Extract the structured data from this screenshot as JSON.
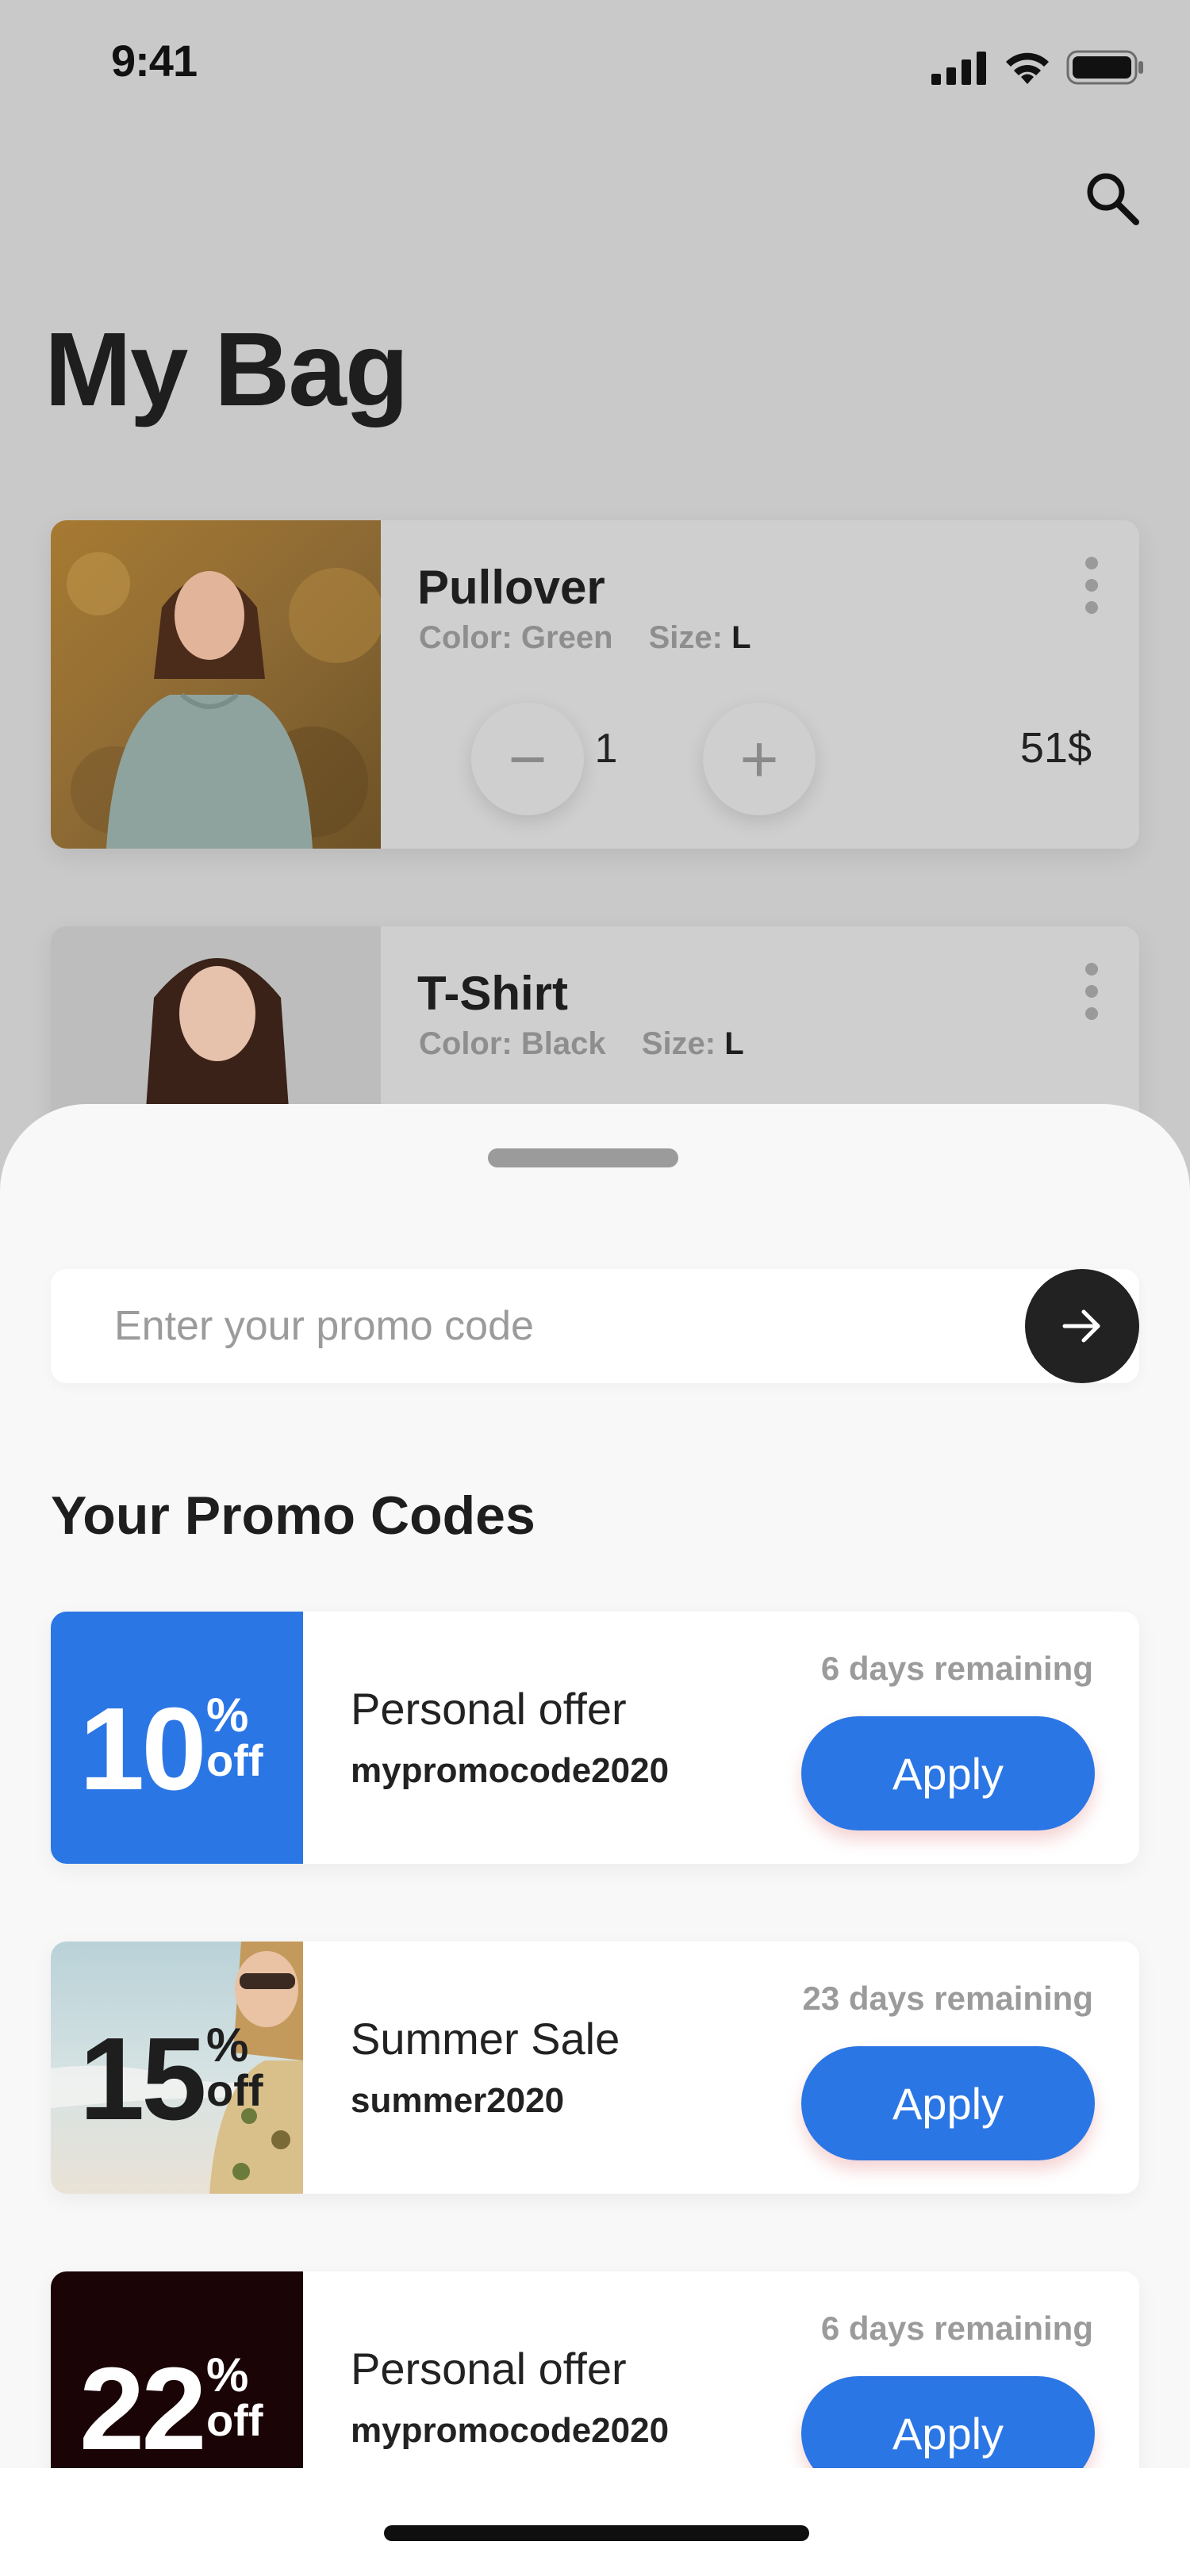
{
  "status_bar": {
    "time": "9:41"
  },
  "header": {
    "title": "My Bag"
  },
  "bag_items": [
    {
      "name": "Pullover",
      "color_label": "Color:",
      "color_value": "Green",
      "size_label": "Size:",
      "size_value": "L",
      "quantity": "1",
      "minus": "−",
      "plus": "+",
      "price": "51$"
    },
    {
      "name": "T-Shirt",
      "color_label": "Color:",
      "color_value": "Black",
      "size_label": "Size:",
      "size_value": "L"
    }
  ],
  "promo_entry": {
    "placeholder": "Enter your promo code"
  },
  "promo_section": {
    "title": "Your Promo Codes"
  },
  "promo_codes": [
    {
      "discount": "10",
      "percent": "%",
      "off": "off",
      "title": "Personal offer",
      "code": "mypromocode2020",
      "remaining": "6 days remaining",
      "apply_label": "Apply",
      "badge_color": "#2b76e5"
    },
    {
      "discount": "15",
      "percent": "%",
      "off": "off",
      "title": "Summer Sale",
      "code": "summer2020",
      "remaining": "23 days remaining",
      "apply_label": "Apply"
    },
    {
      "discount": "22",
      "percent": "%",
      "off": "off",
      "title": "Personal offer",
      "code": "mypromocode2020",
      "remaining": "6 days remaining",
      "apply_label": "Apply",
      "badge_color": "#1a0406"
    }
  ],
  "colors": {
    "accent": "#2b76e5",
    "dim_overlay": "#c9c9c9",
    "sheet": "#f8f8f8",
    "text_dark": "#222222",
    "text_muted": "#9b9b9b"
  },
  "icons": {
    "search": "search-icon",
    "arrow": "arrow-right-icon",
    "more": "more-vertical-icon"
  }
}
